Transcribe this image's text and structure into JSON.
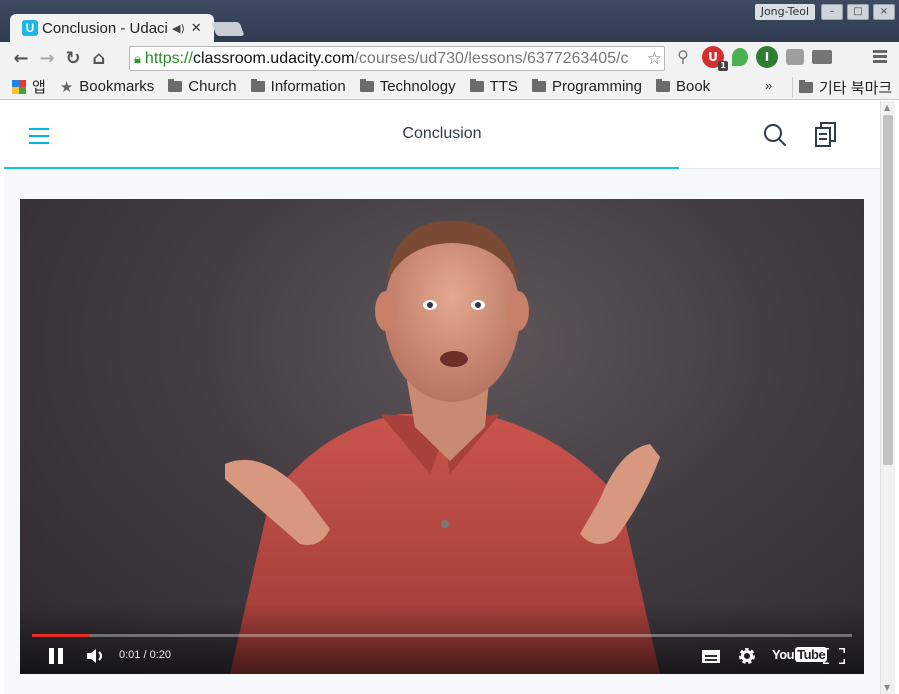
{
  "window": {
    "user_name": "Jong-Teol",
    "tab_title": "Conclusion - Udacity",
    "accent": "#02b3e4"
  },
  "browser": {
    "url_scheme": "https://",
    "url_host": "classroom.udacity.com",
    "url_path": "/courses/ud730/lessons/6377263405/c",
    "extension_badge": "1"
  },
  "bookmarks": {
    "apps_label": "앱",
    "items": [
      "Bookmarks",
      "Church",
      "Information",
      "Technology",
      "TTS",
      "Programming",
      "Book"
    ],
    "more": "»",
    "other_label": "기타 북마크"
  },
  "app": {
    "title": "Conclusion",
    "progress": 0.77,
    "progress_color": "#15c6d1"
  },
  "video": {
    "current_time": "0:01",
    "duration": "0:20",
    "time_display": "0:01 / 0:20",
    "played_fraction": 0.07,
    "brand_you": "You",
    "brand_tube": "Tube",
    "state": "playing"
  }
}
